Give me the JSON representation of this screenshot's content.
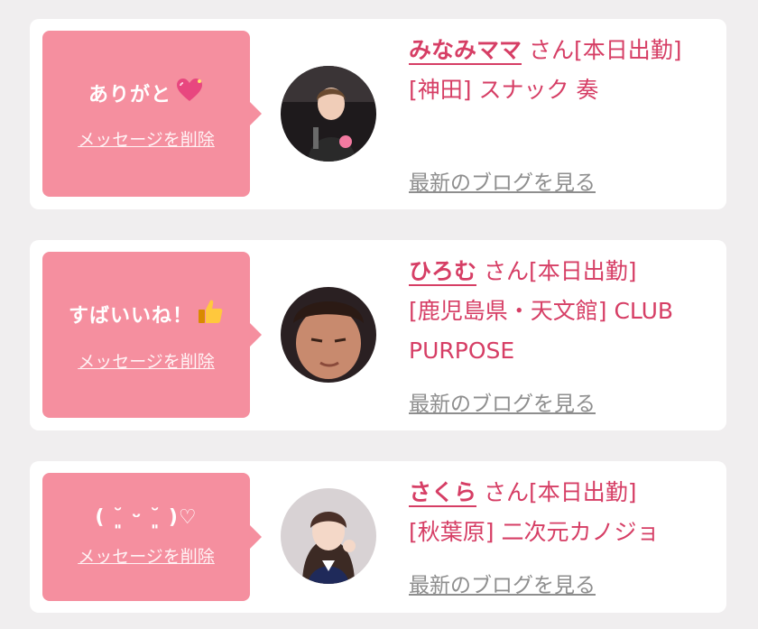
{
  "delete_label": "メッセージを削除",
  "blog_label": "最新のブログを見る",
  "honorific": "さん",
  "cards": [
    {
      "message": "ありがと",
      "message_icon": "sparkling-heart-icon",
      "name": "みなみママ",
      "status": "[本日出勤]",
      "shop": "[神田] スナック 奏"
    },
    {
      "message": "すばいいね！",
      "message_icon": "thumbs-up-icon",
      "name": "ひろむ",
      "status": "[本日出勤]",
      "shop": "[鹿児島県・天文館] CLUB PURPOSE"
    },
    {
      "message": "( ˘͈ ᵕ ˘͈ )♡",
      "message_icon": "",
      "name": "さくら",
      "status": "[本日出勤]",
      "shop": "[秋葉原] 二次元カノジョ"
    }
  ],
  "colors": {
    "accent": "#d63e65",
    "bubble": "#f58f9f",
    "link_gray": "#8e8e8e"
  }
}
